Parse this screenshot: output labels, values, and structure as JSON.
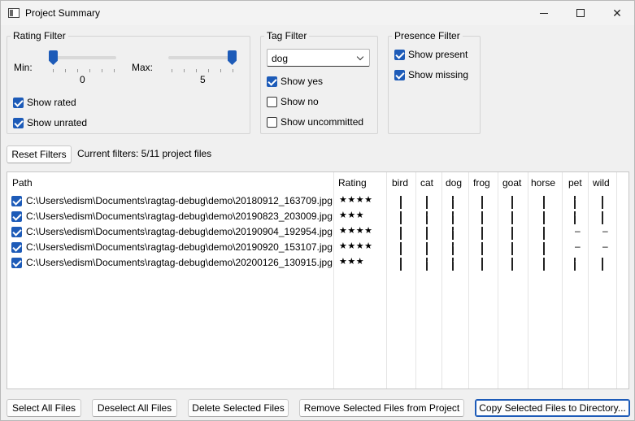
{
  "window": {
    "title": "Project Summary"
  },
  "rating_filter": {
    "title": "Rating Filter",
    "min_label": "Min:",
    "max_label": "Max:",
    "min_value": "0",
    "max_value": "5",
    "min_level": 0,
    "max_level": 1,
    "show_rated": "Show rated",
    "show_unrated": "Show unrated",
    "show_rated_checked": true,
    "show_unrated_checked": true
  },
  "tag_filter": {
    "title": "Tag Filter",
    "selected_tag": "dog",
    "show_yes": "Show yes",
    "show_no": "Show no",
    "show_uncommitted": "Show uncommitted",
    "show_yes_checked": true,
    "show_no_checked": false,
    "show_uncommitted_checked": false
  },
  "presence_filter": {
    "title": "Presence Filter",
    "show_present": "Show present",
    "show_missing": "Show missing",
    "show_present_checked": true,
    "show_missing_checked": true
  },
  "reset_button": "Reset Filters",
  "current_filters": "Current filters: 5/11 project files",
  "table": {
    "headers": [
      "Path",
      "Rating",
      "bird",
      "cat",
      "dog",
      "frog",
      "goat",
      "horse",
      "pet",
      "wild"
    ],
    "rows": [
      {
        "checked": true,
        "path": "C:\\Users\\edism\\Documents\\ragtag-debug\\demo\\20180912_163709.jpg",
        "rating": "★★★★",
        "tags": [
          "no",
          "no",
          "yes",
          "no",
          "no",
          "no",
          "yes",
          "no"
        ]
      },
      {
        "checked": true,
        "path": "C:\\Users\\edism\\Documents\\ragtag-debug\\demo\\20190823_203009.jpg",
        "rating": "★★★",
        "tags": [
          "no",
          "yes",
          "yes",
          "no",
          "no",
          "no",
          "yes",
          "no"
        ]
      },
      {
        "checked": true,
        "path": "C:\\Users\\edism\\Documents\\ragtag-debug\\demo\\20190904_192954.jpg",
        "rating": "★★★★",
        "tags": [
          "no",
          "no",
          "yes",
          "no",
          "no",
          "no",
          "dash",
          "dash"
        ]
      },
      {
        "checked": true,
        "path": "C:\\Users\\edism\\Documents\\ragtag-debug\\demo\\20190920_153107.jpg",
        "rating": "★★★★",
        "tags": [
          "no",
          "no",
          "yes",
          "no",
          "no",
          "no",
          "dash",
          "dash"
        ]
      },
      {
        "checked": true,
        "path": "C:\\Users\\edism\\Documents\\ragtag-debug\\demo\\20200126_130915.jpg",
        "rating": "★★★",
        "tags": [
          "no",
          "yes",
          "yes",
          "no",
          "no",
          "no",
          "yes",
          "no"
        ]
      }
    ]
  },
  "bottom_buttons": {
    "select_all": "Select All Files",
    "deselect_all": "Deselect All Files",
    "delete_selected": "Delete Selected Files",
    "remove_selected": "Remove Selected Files from Project",
    "copy_selected": "Copy Selected Files to Directory..."
  },
  "icons": {
    "app": "app-window-icon",
    "minimize": "minimize-icon",
    "maximize": "maximize-icon",
    "close": "close-icon",
    "dropdown": "chevron-down-icon"
  },
  "colors": {
    "accent": "#1d5bb8"
  }
}
